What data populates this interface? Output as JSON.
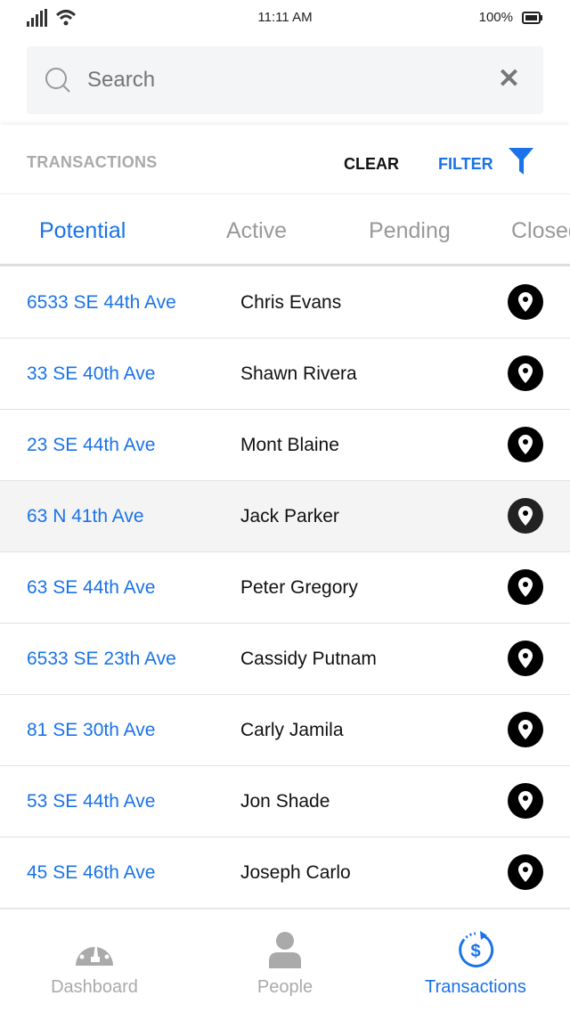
{
  "status_bar": {
    "time": "11:11 AM",
    "battery": "100%"
  },
  "search": {
    "placeholder": "Search"
  },
  "toolbar": {
    "title": "TRANSACTIONS",
    "clear_label": "CLEAR",
    "filter_label": "FILTER"
  },
  "tabs": [
    {
      "label": "Potential",
      "active": true
    },
    {
      "label": "Active"
    },
    {
      "label": "Pending"
    },
    {
      "label": "Closed"
    }
  ],
  "rows": [
    {
      "address": "6533 SE 44th Ave",
      "name": "Chris Evans"
    },
    {
      "address": "33 SE 40th Ave",
      "name": "Shawn Rivera"
    },
    {
      "address": "23 SE 44th Ave",
      "name": "Mont Blaine"
    },
    {
      "address": "63 N 41th Ave",
      "name": "Jack Parker",
      "highlighted": true
    },
    {
      "address": "63 SE 44th Ave",
      "name": "Peter Gregory"
    },
    {
      "address": "6533 SE 23th Ave",
      "name": "Cassidy Putnam"
    },
    {
      "address": "81 SE 30th Ave",
      "name": "Carly Jamila"
    },
    {
      "address": "53 SE 44th Ave",
      "name": "Jon Shade"
    },
    {
      "address": "45 SE 46th Ave",
      "name": "Joseph Carlo"
    }
  ],
  "bottom_nav": [
    {
      "label": "Dashboard",
      "icon": "gauge-icon"
    },
    {
      "label": "People",
      "icon": "person-icon"
    },
    {
      "label": "Transactions",
      "icon": "dollar-cycle-icon",
      "active": true
    }
  ],
  "colors": {
    "accent": "#1a73e8",
    "inactive": "#aaaaaa"
  }
}
